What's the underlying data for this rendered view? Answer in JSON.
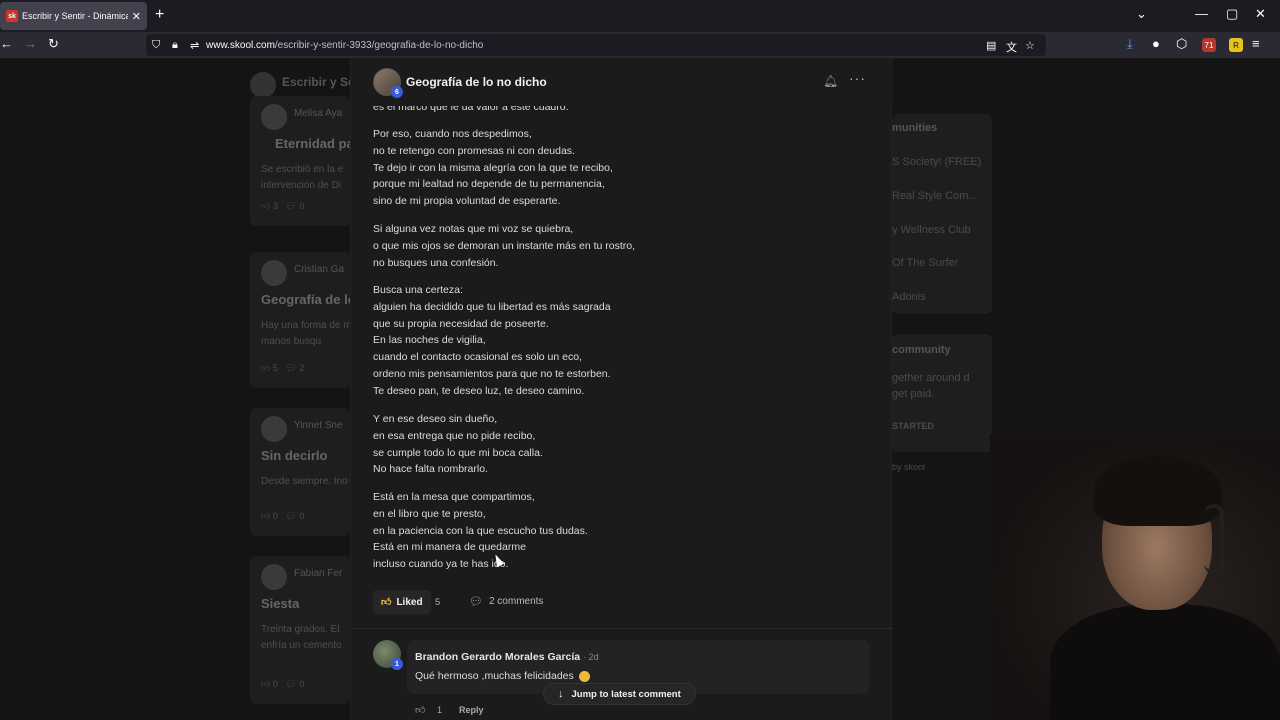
{
  "browser": {
    "tab_title": "Escribir y Sentir - Dinámica Senti",
    "tab_favicon": "sk",
    "url_host": "www.skool.com",
    "url_path": "/escribir-y-sentir-3933/geografia-de-lo-no-dicho",
    "extension_badge": "71"
  },
  "background": {
    "group_name": "Escribir y Se",
    "cards": [
      {
        "author": "Melisa Aya",
        "title": "Eternidad pa",
        "snippet": "Se escribió en la e intervención de Di",
        "likes": "3",
        "comments": "0"
      },
      {
        "author": "Cristian Ga",
        "title": "Geografía de lo",
        "snippet": "Hay una forma de mis manos busqu",
        "likes": "5",
        "comments": "2"
      },
      {
        "author": "Yinnet Sne",
        "title": "Sin decirlo",
        "snippet": "Desde siempre, Ino",
        "likes": "0",
        "comments": "0"
      },
      {
        "author": "Fabian Fer",
        "title": "Siesta",
        "snippet": "Treinta grados. El enfría un cemento",
        "likes": "0",
        "comments": "0"
      }
    ],
    "side_communities": {
      "heading": "munities",
      "items": [
        "S Society! (FREE)",
        "Real Style Com...",
        "y Wellness Club",
        "Of The Surfer",
        "Adonis"
      ]
    },
    "side_create": {
      "heading": "community",
      "text": "gether around d get paid.",
      "cta": "STARTED",
      "footer": "by skool"
    }
  },
  "post": {
    "title": "Geografía de lo no dicho",
    "author_level": "6",
    "paragraphs": [
      [
        "es el marco que le da valor a este cuadro."
      ],
      [
        "Por eso, cuando nos despedimos,",
        "no te retengo con promesas ni con deudas.",
        "Te dejo ir con la misma alegría con la que te recibo,",
        "porque mi lealtad no depende de tu permanencia,",
        "sino de mi propia voluntad de esperarte."
      ],
      [
        "Si alguna vez notas que mi voz se quiebra,",
        "o que mis ojos se demoran un instante más en tu rostro,",
        "no busques una confesión."
      ],
      [
        "Busca una certeza:",
        "alguien ha decidido que tu libertad es más sagrada",
        "que su propia necesidad de poseerte.",
        "En las noches de vigilia,",
        "cuando el contacto ocasional es solo un eco,",
        "ordeno mis pensamientos para que no te estorben.",
        "Te deseo pan, te deseo luz, te deseo camino."
      ],
      [
        "Y en ese deseo sin dueño,",
        "en esa entrega que no pide recibo,",
        "se cumple todo lo que mi boca calla.",
        "No hace falta nombrarlo."
      ],
      [
        "Está en la mesa que compartimos,",
        "en el libro que te presto,",
        "en la paciencia con la que escucho tus dudas.",
        "Está en mi manera de quedarme",
        "incluso cuando ya te has ido."
      ]
    ],
    "liked_label": "Liked",
    "like_count": "5",
    "comments_label": "2 comments"
  },
  "comment": {
    "author": "Brandon Gerardo Morales García",
    "author_level": "1",
    "time": "· 2d",
    "text": "Qué hermoso ,muchas felicidades",
    "like_count": "1",
    "reply_label": "Reply"
  },
  "jump_label": "Jump to latest comment"
}
